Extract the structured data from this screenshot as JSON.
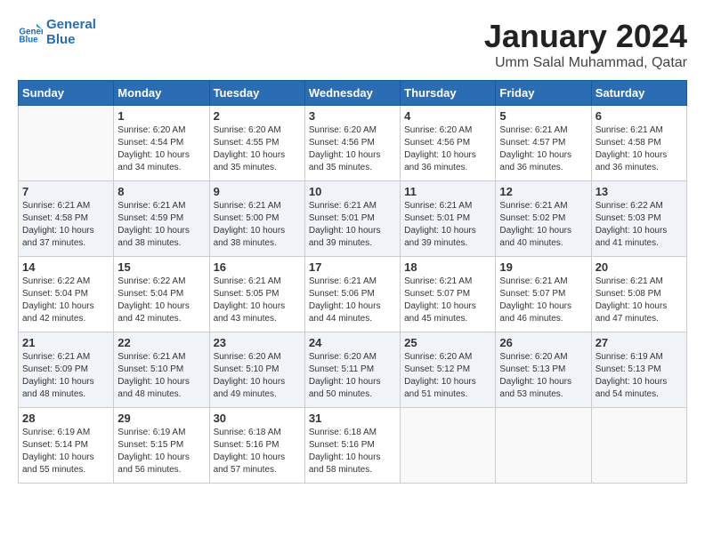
{
  "logo": {
    "line1": "General",
    "line2": "Blue"
  },
  "title": "January 2024",
  "location": "Umm Salal Muhammad, Qatar",
  "days_header": [
    "Sunday",
    "Monday",
    "Tuesday",
    "Wednesday",
    "Thursday",
    "Friday",
    "Saturday"
  ],
  "weeks": [
    [
      {
        "num": "",
        "info": ""
      },
      {
        "num": "1",
        "info": "Sunrise: 6:20 AM\nSunset: 4:54 PM\nDaylight: 10 hours\nand 34 minutes."
      },
      {
        "num": "2",
        "info": "Sunrise: 6:20 AM\nSunset: 4:55 PM\nDaylight: 10 hours\nand 35 minutes."
      },
      {
        "num": "3",
        "info": "Sunrise: 6:20 AM\nSunset: 4:56 PM\nDaylight: 10 hours\nand 35 minutes."
      },
      {
        "num": "4",
        "info": "Sunrise: 6:20 AM\nSunset: 4:56 PM\nDaylight: 10 hours\nand 36 minutes."
      },
      {
        "num": "5",
        "info": "Sunrise: 6:21 AM\nSunset: 4:57 PM\nDaylight: 10 hours\nand 36 minutes."
      },
      {
        "num": "6",
        "info": "Sunrise: 6:21 AM\nSunset: 4:58 PM\nDaylight: 10 hours\nand 36 minutes."
      }
    ],
    [
      {
        "num": "7",
        "info": "Sunrise: 6:21 AM\nSunset: 4:58 PM\nDaylight: 10 hours\nand 37 minutes."
      },
      {
        "num": "8",
        "info": "Sunrise: 6:21 AM\nSunset: 4:59 PM\nDaylight: 10 hours\nand 38 minutes."
      },
      {
        "num": "9",
        "info": "Sunrise: 6:21 AM\nSunset: 5:00 PM\nDaylight: 10 hours\nand 38 minutes."
      },
      {
        "num": "10",
        "info": "Sunrise: 6:21 AM\nSunset: 5:01 PM\nDaylight: 10 hours\nand 39 minutes."
      },
      {
        "num": "11",
        "info": "Sunrise: 6:21 AM\nSunset: 5:01 PM\nDaylight: 10 hours\nand 39 minutes."
      },
      {
        "num": "12",
        "info": "Sunrise: 6:21 AM\nSunset: 5:02 PM\nDaylight: 10 hours\nand 40 minutes."
      },
      {
        "num": "13",
        "info": "Sunrise: 6:22 AM\nSunset: 5:03 PM\nDaylight: 10 hours\nand 41 minutes."
      }
    ],
    [
      {
        "num": "14",
        "info": "Sunrise: 6:22 AM\nSunset: 5:04 PM\nDaylight: 10 hours\nand 42 minutes."
      },
      {
        "num": "15",
        "info": "Sunrise: 6:22 AM\nSunset: 5:04 PM\nDaylight: 10 hours\nand 42 minutes."
      },
      {
        "num": "16",
        "info": "Sunrise: 6:21 AM\nSunset: 5:05 PM\nDaylight: 10 hours\nand 43 minutes."
      },
      {
        "num": "17",
        "info": "Sunrise: 6:21 AM\nSunset: 5:06 PM\nDaylight: 10 hours\nand 44 minutes."
      },
      {
        "num": "18",
        "info": "Sunrise: 6:21 AM\nSunset: 5:07 PM\nDaylight: 10 hours\nand 45 minutes."
      },
      {
        "num": "19",
        "info": "Sunrise: 6:21 AM\nSunset: 5:07 PM\nDaylight: 10 hours\nand 46 minutes."
      },
      {
        "num": "20",
        "info": "Sunrise: 6:21 AM\nSunset: 5:08 PM\nDaylight: 10 hours\nand 47 minutes."
      }
    ],
    [
      {
        "num": "21",
        "info": "Sunrise: 6:21 AM\nSunset: 5:09 PM\nDaylight: 10 hours\nand 48 minutes."
      },
      {
        "num": "22",
        "info": "Sunrise: 6:21 AM\nSunset: 5:10 PM\nDaylight: 10 hours\nand 48 minutes."
      },
      {
        "num": "23",
        "info": "Sunrise: 6:20 AM\nSunset: 5:10 PM\nDaylight: 10 hours\nand 49 minutes."
      },
      {
        "num": "24",
        "info": "Sunrise: 6:20 AM\nSunset: 5:11 PM\nDaylight: 10 hours\nand 50 minutes."
      },
      {
        "num": "25",
        "info": "Sunrise: 6:20 AM\nSunset: 5:12 PM\nDaylight: 10 hours\nand 51 minutes."
      },
      {
        "num": "26",
        "info": "Sunrise: 6:20 AM\nSunset: 5:13 PM\nDaylight: 10 hours\nand 53 minutes."
      },
      {
        "num": "27",
        "info": "Sunrise: 6:19 AM\nSunset: 5:13 PM\nDaylight: 10 hours\nand 54 minutes."
      }
    ],
    [
      {
        "num": "28",
        "info": "Sunrise: 6:19 AM\nSunset: 5:14 PM\nDaylight: 10 hours\nand 55 minutes."
      },
      {
        "num": "29",
        "info": "Sunrise: 6:19 AM\nSunset: 5:15 PM\nDaylight: 10 hours\nand 56 minutes."
      },
      {
        "num": "30",
        "info": "Sunrise: 6:18 AM\nSunset: 5:16 PM\nDaylight: 10 hours\nand 57 minutes."
      },
      {
        "num": "31",
        "info": "Sunrise: 6:18 AM\nSunset: 5:16 PM\nDaylight: 10 hours\nand 58 minutes."
      },
      {
        "num": "",
        "info": ""
      },
      {
        "num": "",
        "info": ""
      },
      {
        "num": "",
        "info": ""
      }
    ]
  ]
}
